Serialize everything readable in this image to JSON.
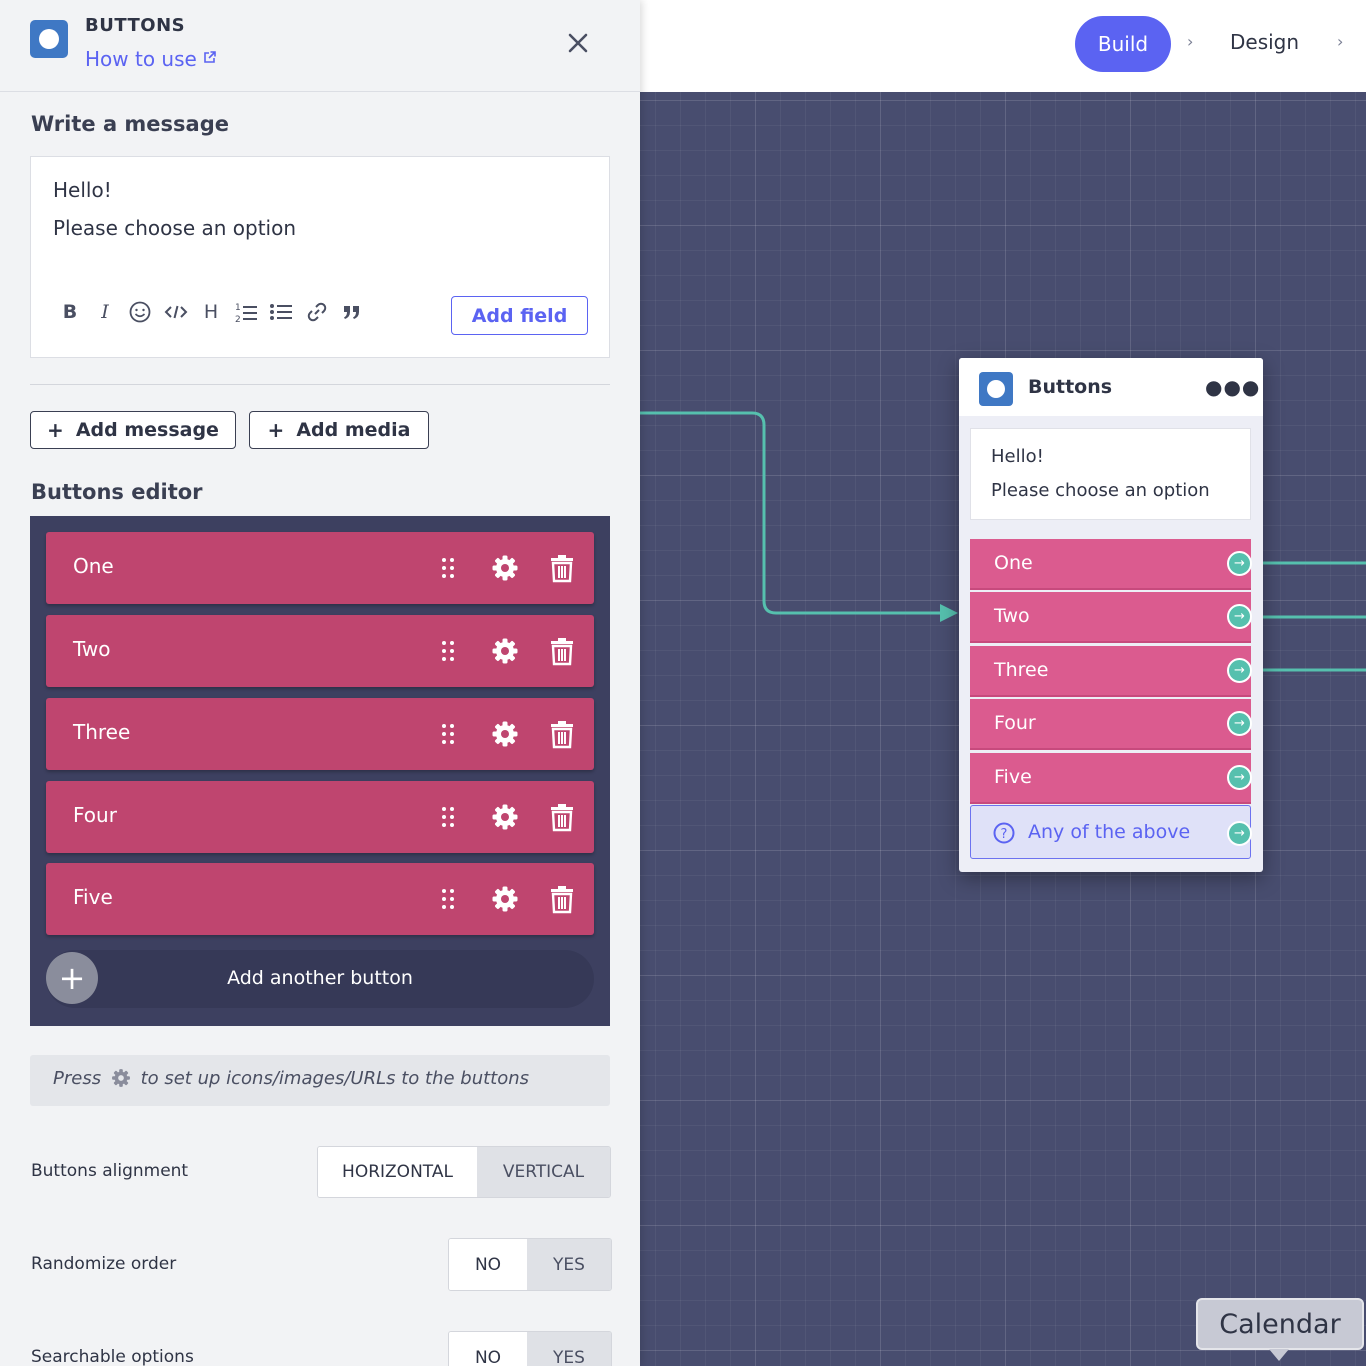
{
  "panel": {
    "title": "BUTTONS",
    "how_to_use": "How to use",
    "write_message_title": "Write a message",
    "message_lines": [
      "Hello!",
      "Please choose an option"
    ],
    "toolbar": {
      "bold": "B",
      "italic": "I",
      "heading": "H",
      "add_field": "Add field"
    },
    "add_message": "Add message",
    "add_media": "Add media",
    "buttons_editor_title": "Buttons editor",
    "buttons": [
      "One",
      "Two",
      "Three",
      "Four",
      "Five"
    ],
    "add_another_button": "Add another button",
    "hint_before": "Press",
    "hint_after": "to set up icons/images/URLs to the buttons",
    "alignment": {
      "label": "Buttons alignment",
      "options": [
        "HORIZONTAL",
        "VERTICAL"
      ],
      "selected": "HORIZONTAL"
    },
    "randomize": {
      "label": "Randomize order",
      "options": [
        "NO",
        "YES"
      ],
      "selected": "NO"
    },
    "searchable": {
      "label": "Searchable options",
      "options": [
        "NO",
        "YES"
      ],
      "selected": "NO"
    }
  },
  "topbar": {
    "steps": [
      "Build",
      "Design"
    ],
    "active_step": "Build"
  },
  "node": {
    "title": "Buttons",
    "message_lines": [
      "Hello!",
      "Please choose an option"
    ],
    "buttons": [
      "One",
      "Two",
      "Three",
      "Four",
      "Five"
    ],
    "fallback": "Any of the above"
  },
  "tooltip": {
    "text": "Calendar"
  },
  "colors": {
    "accent": "#5b63f2",
    "button_pink": "#bf456f",
    "node_button_pink": "#db5b8f",
    "connector_teal": "#56c0ae",
    "editor_bg": "#3d4060",
    "canvas_bg": "#484d6f",
    "logo_blue": "#3f78c4"
  }
}
